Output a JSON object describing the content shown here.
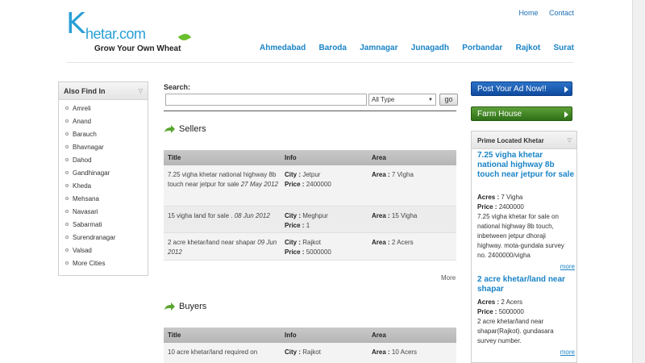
{
  "logo": {
    "k": "K",
    "word": "hetar.com",
    "tagline": "Grow Your Own Wheat"
  },
  "toplinks": [
    "Home",
    "Contact"
  ],
  "cities": [
    "Ahmedabad",
    "Baroda",
    "Jamnagar",
    "Junagadh",
    "Porbandar",
    "Rajkot",
    "Surat"
  ],
  "left": {
    "title": "Also Find In",
    "items": [
      "Amreli",
      "Anand",
      "Barauch",
      "Bhavnagar",
      "Dahod",
      "Gandhinagar",
      "Kheda",
      "Mehsana",
      "Navasari",
      "Sabarmati",
      "Surendranagar",
      "Valsad",
      "More Cities"
    ]
  },
  "search": {
    "label": "Search:",
    "select_value": "All Type",
    "go": "go"
  },
  "sellers": {
    "title": "Sellers",
    "headers": [
      "Title",
      "Info",
      "Area"
    ],
    "rows": [
      {
        "title": "7.25 vigha khetar national highway 8b touch near jetpur for sale",
        "date": "27 May 2012",
        "city": "Jetpur",
        "price": "2400000",
        "area": "7 Vigha"
      },
      {
        "title": "15 vigha land for sale .",
        "date": "08 Jun 2012",
        "city": "Meghpur",
        "price": "1",
        "area": "15 Vigha"
      },
      {
        "title": "2 acre khetar/land near shapar",
        "date": "09 Jun 2012",
        "city": "Rajkot",
        "price": "5000000",
        "area": "2 Acers"
      }
    ],
    "more": "More"
  },
  "buyers": {
    "title": "Buyers",
    "headers": [
      "Title",
      "Info",
      "Area"
    ],
    "rows": [
      {
        "title": "10 acre khetar/land required on",
        "city": "Rajkot",
        "area": "10 Acers"
      }
    ]
  },
  "labels": {
    "city": "City :",
    "price": "Price :",
    "area": "Area :",
    "acres": "Acres :"
  },
  "right": {
    "post_ad": "Post Your Ad Now!!",
    "farm_house": "Farm House",
    "panel_title": "Prime Located Khetar",
    "listings": [
      {
        "title": "7.25 vigha khetar national highway 8b touch near jetpur for sale",
        "size_label": "Acres :",
        "size": "7 Vigha",
        "price": "2400000",
        "desc": [
          "7.25 vigha khetar for sale on",
          "national highway 8b touch,",
          "inbetween jetpur dhoraji",
          "highway. mota-gundala survey",
          "no. 2400000/vigha"
        ],
        "more": "more"
      },
      {
        "title": "2 acre khetar/land near shapar",
        "size_label": "Acres :",
        "size": "2 Acers",
        "price": "5000000",
        "desc": [
          "2 acre khetar/land near",
          "shapar(Rajkot). gundasara",
          "survey number."
        ],
        "more": "more"
      }
    ]
  },
  "colors": {
    "brand_blue": "#2a9fd6",
    "nav_blue": "#1a84c7",
    "ad_blue": "#0f4a9e",
    "farm_green": "#2d6f16"
  }
}
